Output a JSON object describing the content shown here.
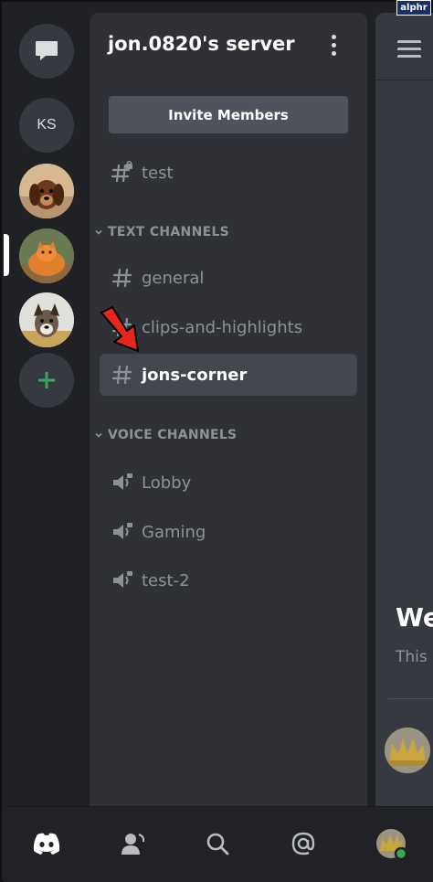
{
  "watermark": "alphr",
  "server": {
    "name": "jon.0820's server",
    "invite_label": "Invite Members"
  },
  "rail": {
    "items": [
      {
        "icon": "message-icon"
      },
      {
        "label": "KS"
      },
      {
        "icon": "dog-avatar"
      },
      {
        "icon": "cat-avatar"
      },
      {
        "icon": "dog-avatar-2"
      },
      {
        "icon": "plus-icon"
      }
    ]
  },
  "channels": {
    "top": [
      {
        "name": "test",
        "type": "text-locked"
      }
    ],
    "text_category": "TEXT CHANNELS",
    "text": [
      {
        "name": "general"
      },
      {
        "name": "clips-and-highlights"
      },
      {
        "name": "jons-corner",
        "active": true
      }
    ],
    "voice_category": "VOICE CHANNELS",
    "voice": [
      {
        "name": "Lobby"
      },
      {
        "name": "Gaming"
      },
      {
        "name": "test-2"
      }
    ]
  },
  "chat": {
    "welcome_title": "We",
    "welcome_sub": "This"
  },
  "nav": {
    "items": [
      "discord-icon",
      "friends-icon",
      "search-icon",
      "mentions-icon",
      "profile-avatar"
    ]
  },
  "colors": {
    "background": "#1f2124",
    "panel": "#2f3136",
    "active_channel": "#42464d",
    "online": "#3ba55d",
    "arrow": "#e5261c"
  }
}
